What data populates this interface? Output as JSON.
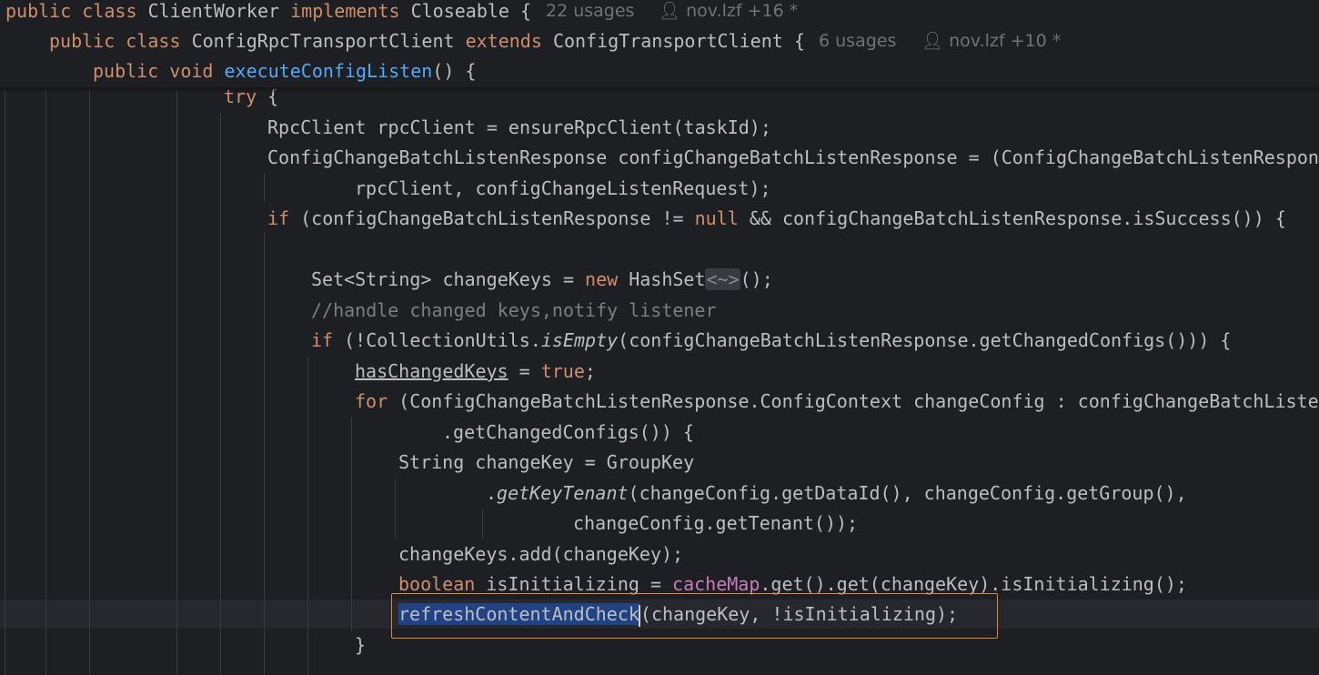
{
  "sticky": {
    "class_line": {
      "kw1": "public",
      "kw2": "class",
      "name": "ClientWorker",
      "kw3": "implements",
      "iface": "Closeable",
      "brace": "{",
      "usages": "22 usages",
      "author": "nov.lzf +16 *"
    },
    "inner_class_line": {
      "kw1": "public",
      "kw2": "class",
      "name": "ConfigRpcTransportClient",
      "kw3": "extends",
      "parent": "ConfigTransportClient",
      "brace": "{",
      "usages": "6 usages",
      "author": "nov.lzf +10 *"
    },
    "method_line": {
      "kw1": "public",
      "kw2": "void",
      "name": "executeConfigListen",
      "rest": "() {"
    }
  },
  "code": {
    "l1_try": "try",
    "l1_rest": " {",
    "l2": "RpcClient rpcClient = ensureRpcClient(taskId);",
    "l3": "ConfigChangeBatchListenResponse configChangeBatchListenResponse = (ConfigChangeBatchListenResponse",
    "l4": "rpcClient, configChangeListenRequest);",
    "l5_if": "if",
    "l5_a": " (configChangeBatchListenResponse != ",
    "l5_null": "null",
    "l5_b": " && configChangeBatchListenResponse.isSuccess()) {",
    "l7_a": "Set<String> changeKeys = ",
    "l7_new": "new",
    "l7_b": " HashSet",
    "l7_inlay": "<~>",
    "l7_c": "();",
    "l8_comment": "//handle changed keys,notify listener",
    "l9_if": "if",
    "l9_a": " (!CollectionUtils.",
    "l9_method": "isEmpty",
    "l9_b": "(configChangeBatchListenResponse.getChangedConfigs())) {",
    "l10_var": "hasChangedKeys",
    "l10_a": " = ",
    "l10_true": "true",
    "l10_b": ";",
    "l11_for": "for",
    "l11_a": " (ConfigChangeBatchListenResponse.ConfigContext changeConfig : configChangeBatchListenResponse",
    "l12": ".getChangedConfigs()) {",
    "l13": "String changeKey = GroupKey",
    "l14_a": ".",
    "l14_method": "getKeyTenant",
    "l14_b": "(changeConfig.getDataId(), changeConfig.getGroup(),",
    "l15": "changeConfig.getTenant());",
    "l16": "changeKeys.add(changeKey);",
    "l17_type": "boolean",
    "l17_a": " isInitializing = ",
    "l17_field": "cacheMap",
    "l17_b": ".get().get(changeKey).isInitializing();",
    "l18_selected": "refreshContentAndCheck",
    "l18_rest": "(changeKey, !isInitializing);",
    "l19": "}"
  }
}
